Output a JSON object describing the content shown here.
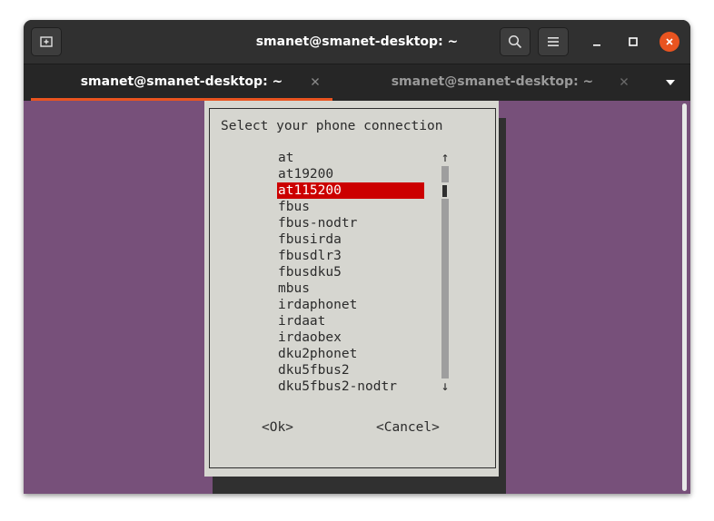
{
  "window": {
    "title": "smanet@smanet-desktop: ~",
    "new_tab_icon": "new-tab-icon",
    "search_icon": "search-icon",
    "menu_icon": "hamburger-menu-icon",
    "minimize_icon": "minimize-icon",
    "maximize_icon": "maximize-icon",
    "close_icon": "close-icon"
  },
  "tabs": [
    {
      "label": "smanet@smanet-desktop: ~",
      "active": true
    },
    {
      "label": "smanet@smanet-desktop: ~",
      "active": false
    }
  ],
  "dialog": {
    "prompt": "Select your phone connection",
    "options": [
      "at",
      "at19200",
      "at115200",
      "fbus",
      "fbus-nodtr",
      "fbusirda",
      "fbusdlr3",
      "fbusdku5",
      "mbus",
      "irdaphonet",
      "irdaat",
      "irdaobex",
      "dku2phonet",
      "dku5fbus2",
      "dku5fbus2-nodtr"
    ],
    "selected_option": "at115200",
    "scroll_up_arrow": "↑",
    "scroll_down_arrow": "↓",
    "ok_label": "<Ok>",
    "cancel_label": "<Cancel>"
  },
  "colors": {
    "accent": "#e95420",
    "terminal_bg": "#77507a",
    "dialog_bg": "#d6d6d0",
    "selection_bg": "#cc0000"
  }
}
